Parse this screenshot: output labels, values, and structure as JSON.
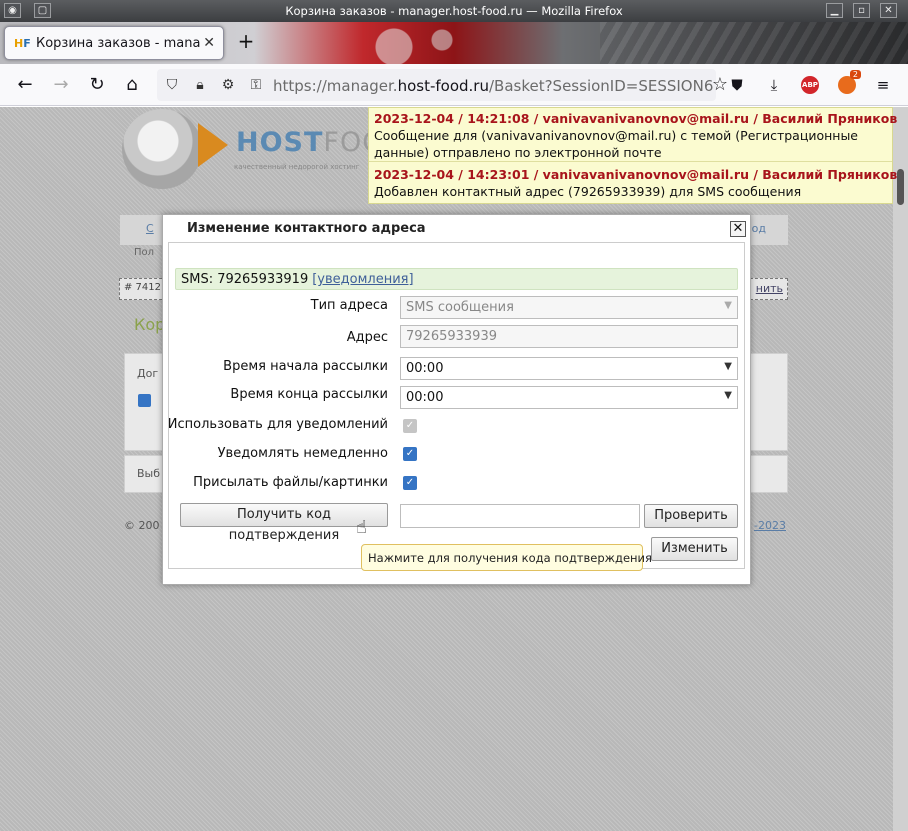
{
  "window": {
    "title": "Корзина заказов - manager.host-food.ru — Mozilla Firefox"
  },
  "browser": {
    "tab_title": "Корзина заказов - manager.host-food.ru",
    "url_prefix": "https://manager.",
    "url_domain": "host-food.ru",
    "url_path": "/Basket?SessionID=SESSION656dbd",
    "extension_badge": "2",
    "abp_label": "ABP"
  },
  "site": {
    "logo_primary": "HOST",
    "logo_secondary": "FOOD",
    "slogan": "качественный недорогой хостинг",
    "menu_left": "С",
    "menu_right": "од",
    "polz": "Пол",
    "order_left": "# 7412",
    "order_right": "нить",
    "heading": "Кор",
    "panel1_label": "Дог",
    "panel2_label": "Выб",
    "footer_left": "© 200",
    "footer_right": "-2023"
  },
  "notifications": [
    {
      "header": "2023-12-04 / 14:21:08 / vanivavanivanovnov@mail.ru / Василий Пряников",
      "body": "Сообщение для (vanivavanivanovnov@mail.ru) с темой (Регистрационные данные) отправлено по электронной почте"
    },
    {
      "header": "2023-12-04 / 14:23:01 / vanivavanivanovnov@mail.ru / Василий Пряников",
      "body": "Добавлен контактный адрес (79265933939) для SMS сообщения"
    }
  ],
  "modal": {
    "title": "Изменение контактного адреса",
    "sms_line": "SMS: 79265933919",
    "sms_link": "[уведомления]",
    "fields": {
      "address_type_label": "Тип адреса",
      "address_type_value": "SMS сообщения",
      "address_label": "Адрес",
      "address_value": "79265933939",
      "start_label": "Время начала рассылки",
      "start_value": "00:00",
      "end_label": "Время конца рассылки",
      "end_value": "00:00",
      "use_notify_label": "Использовать для уведомлений",
      "notify_now_label": "Уведомлять немедленно",
      "send_files_label": "Присылать файлы/картинки"
    },
    "checkboxes": {
      "use_notify": true,
      "notify_now": true,
      "send_files": true
    },
    "get_code_button": "Получить код подтверждения",
    "code_value": "",
    "check_button": "Проверить",
    "change_button": "Изменить",
    "tooltip": "Нажмите для получения кода подтверждения"
  },
  "colors": {
    "accent_link": "#3f5f99",
    "notice_header": "#a8141b",
    "notice_bg": "#fbfbd0",
    "checkbox_checked": "#3574c4",
    "sms_bar_bg": "#e6f3dc"
  }
}
